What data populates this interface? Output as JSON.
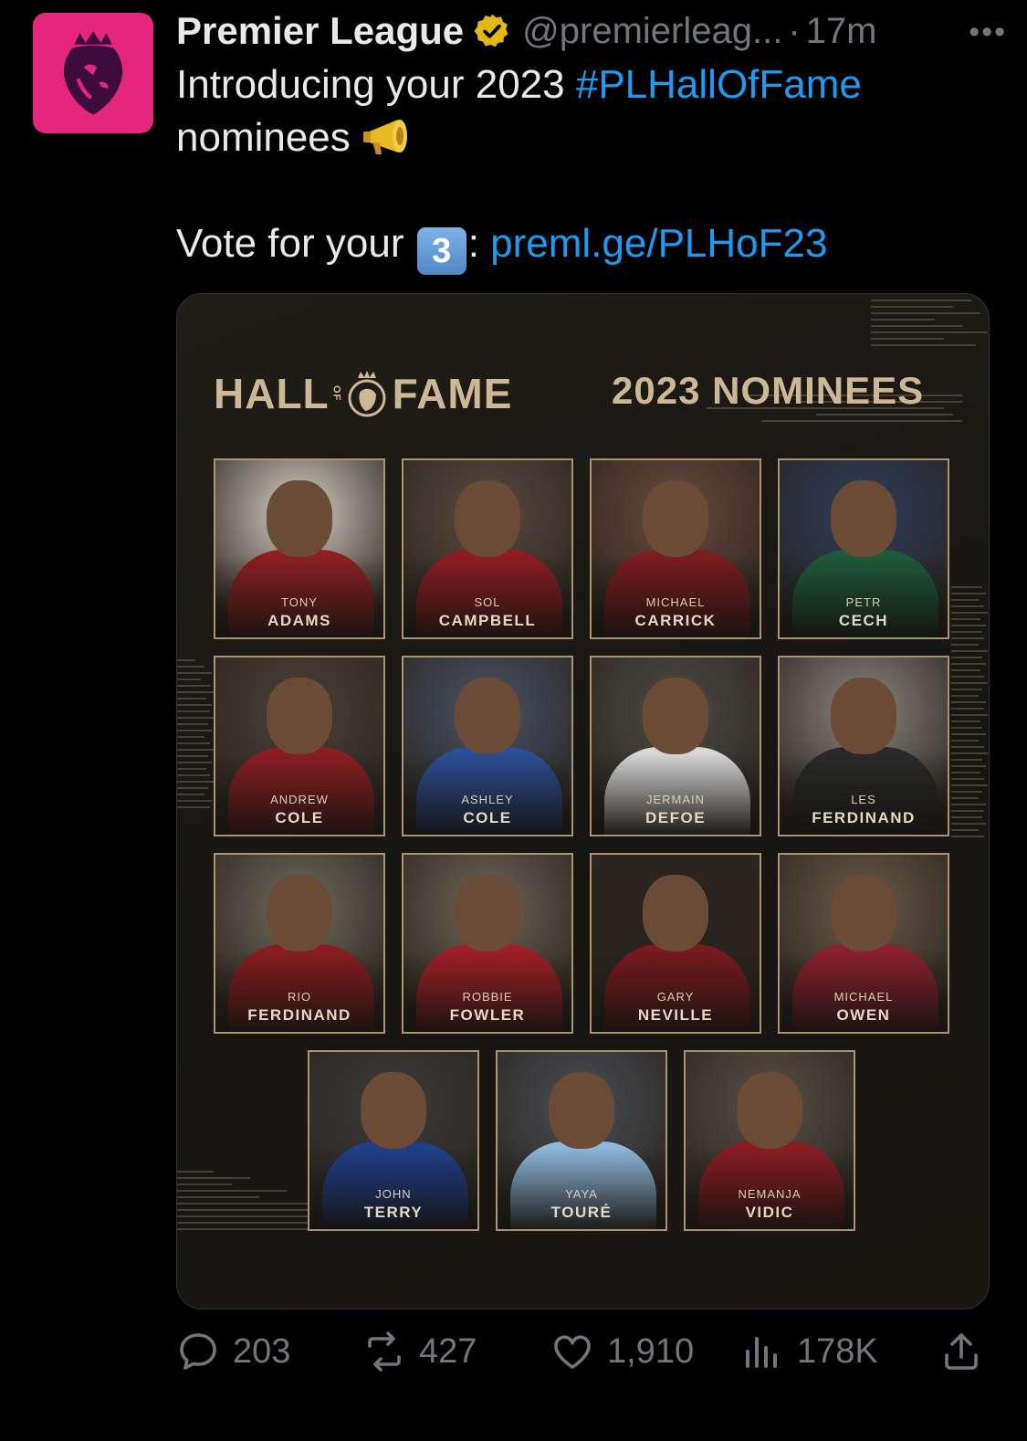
{
  "account": {
    "display_name": "Premier League",
    "handle": "@premierleag...",
    "separator": "·",
    "time": "17m",
    "more_icon": "more-icon",
    "verified_icon": "gold-verified-badge-icon",
    "avatar_bg": "#e6267c"
  },
  "tweet": {
    "line1_prefix": "Introducing your 2023 ",
    "hashtag": "#PLHallOfFame",
    "line2": "nominees",
    "line2_emoji": "megaphone-emoji",
    "vote_prefix": "Vote for your ",
    "vote_keycap": "3",
    "vote_colon": ":",
    "link": "preml.ge/PLHoF23"
  },
  "card": {
    "hall": "HALL",
    "of": "OF",
    "fame": "FAME",
    "subtitle": "2023 NOMINEES",
    "nominees": [
      {
        "first": "TONY",
        "last": "ADAMS",
        "shirt": "#8e1f22",
        "bg": "#d9d2c6"
      },
      {
        "first": "SOL",
        "last": "CAMPBELL",
        "shirt": "#8f1d22",
        "bg": "#5a4a40"
      },
      {
        "first": "MICHAEL",
        "last": "CARRICK",
        "shirt": "#7d1c1f",
        "bg": "#6b4a3e"
      },
      {
        "first": "PETR",
        "last": "CECH",
        "shirt": "#1f5a3a",
        "bg": "#2d3d5c"
      },
      {
        "first": "ANDREW",
        "last": "COLE",
        "shirt": "#8c1e21",
        "bg": "#4d3f38"
      },
      {
        "first": "ASHLEY",
        "last": "COLE",
        "shirt": "#2b4f96",
        "bg": "#4a5366"
      },
      {
        "first": "JERMAIN",
        "last": "DEFOE",
        "shirt": "#d8d8d8",
        "bg": "#4e4a44"
      },
      {
        "first": "LES",
        "last": "FERDINAND",
        "shirt": "#2a2a2a",
        "bg": "#8b8680"
      },
      {
        "first": "RIO",
        "last": "FERDINAND",
        "shirt": "#8a1c1f",
        "bg": "#6f6a5a"
      },
      {
        "first": "ROBBIE",
        "last": "FOWLER",
        "shirt": "#a11f24",
        "bg": "#6f6458"
      },
      {
        "first": "GARY",
        "last": "NEVILLE",
        "shirt": "#7a1a1d",
        "bg": "#2a2420"
      },
      {
        "first": "MICHAEL",
        "last": "OWEN",
        "shirt": "#8c2030",
        "bg": "#6a5a4a"
      },
      {
        "first": "JOHN",
        "last": "TERRY",
        "shirt": "#1f3f8a",
        "bg": "#3c3c3c"
      },
      {
        "first": "YAYA",
        "last": "TOURÉ",
        "shirt": "#8fb9dc",
        "bg": "#4a4e55"
      },
      {
        "first": "NEMANJA",
        "last": "VIDIC",
        "shirt": "#8a1c22",
        "bg": "#5a4f48"
      }
    ]
  },
  "stats": {
    "replies": "203",
    "reposts": "427",
    "likes": "1,910",
    "views": "178K",
    "reply_icon": "reply-icon",
    "repost_icon": "repost-icon",
    "like_icon": "heart-icon",
    "views_icon": "views-icon",
    "share_icon": "share-icon"
  }
}
